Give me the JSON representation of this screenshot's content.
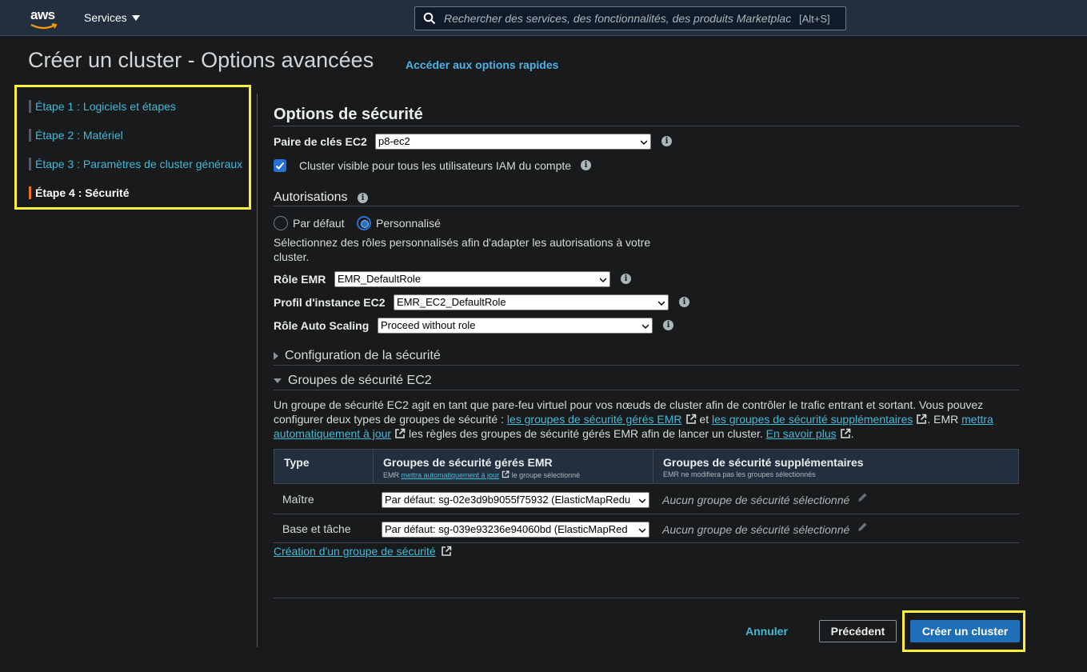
{
  "topbar": {
    "logo": "aws",
    "services_label": "Services",
    "search_placeholder": "Rechercher des services, des fonctionnalités, des produits Marketplac",
    "search_shortcut": "[Alt+S]"
  },
  "page": {
    "title": "Créer un cluster - Options avancées",
    "quick_options_link": "Accéder aux options rapides"
  },
  "steps": [
    {
      "label": "Étape 1 : Logiciels et étapes",
      "active": false
    },
    {
      "label": "Étape 2 : Matériel",
      "active": false
    },
    {
      "label": "Étape 3 : Paramètres de cluster généraux",
      "active": false
    },
    {
      "label": "Étape 4 : Sécurité",
      "active": true
    }
  ],
  "security": {
    "title": "Options de sécurité",
    "ec2_key_pair_label": "Paire de clés EC2",
    "ec2_key_pair_value": "p8-ec2",
    "visible_label": "Cluster visible pour tous les utilisateurs IAM du compte",
    "visible_checked": true
  },
  "permissions": {
    "title": "Autorisations",
    "option_default": "Par défaut",
    "option_custom": "Personnalisé",
    "selected": "Personnalisé",
    "description": "Sélectionnez des rôles personnalisés afin d'adapter les autorisations à votre cluster.",
    "emr_role_label": "Rôle EMR",
    "emr_role_value": "EMR_DefaultRole",
    "instance_profile_label": "Profil d'instance EC2",
    "instance_profile_value": "EMR_EC2_DefaultRole",
    "autoscaling_role_label": "Rôle Auto Scaling",
    "autoscaling_role_value": "Proceed without role"
  },
  "security_config": {
    "title": "Configuration de la sécurité"
  },
  "ec2_groups": {
    "title": "Groupes de sécurité EC2",
    "para_1": "Un groupe de sécurité EC2 agit en tant que pare-feu virtuel pour vos nœuds de cluster afin de contrôler le trafic entrant et sortant. Vous pouvez configurer deux types de groupes de sécurité : ",
    "link_managed": "les groupes de sécurité gérés EMR",
    "para_2": " et ",
    "link_additional": "les groupes de sécurité supplémentaires",
    "para_3": ". EMR ",
    "link_update": "mettra automatiquement à jour",
    "para_4": " les règles des groupes de sécurité gérés EMR afin de lancer un cluster. ",
    "link_learn": "En savoir plus",
    "para_5": ".",
    "col_type": "Type",
    "col_managed": "Groupes de sécurité gérés EMR",
    "col_managed_sub_1": "EMR ",
    "col_managed_sub_link": "mettra automatiquement à jour",
    "col_managed_sub_2": " le groupe sélectionné",
    "col_additional": "Groupes de sécurité supplémentaires",
    "col_additional_sub": "EMR ne modifiera pas les groupes sélectionnés",
    "rows": [
      {
        "type": "Maître",
        "managed": "Par défaut: sg-02e3d9b9055f75932 (ElasticMapRedu",
        "additional": "Aucun groupe de sécurité sélectionné"
      },
      {
        "type": "Base et tâche",
        "managed": "Par défaut: sg-039e93236e94060bd (ElasticMapRed",
        "additional": "Aucun groupe de sécurité sélectionné"
      }
    ],
    "create_link": "Création d'un groupe de sécurité"
  },
  "footer": {
    "cancel": "Annuler",
    "previous": "Précédent",
    "create": "Créer un cluster"
  },
  "colors": {
    "background": "#191a1c",
    "topbar": "#232f3e",
    "link": "#44b9d6",
    "accent_orange": "#ec7211",
    "primary_button": "#1f6fb8",
    "highlight": "#ffef3d"
  }
}
